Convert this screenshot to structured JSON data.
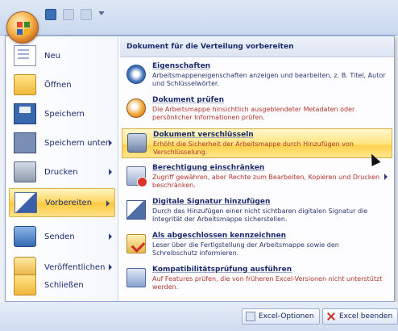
{
  "left_menu": {
    "items": [
      {
        "label": "Neu",
        "icon": "new-document-icon",
        "submenu": false
      },
      {
        "label": "Öffnen",
        "icon": "open-folder-icon",
        "submenu": false
      },
      {
        "label": "Speichern",
        "icon": "save-icon",
        "submenu": false
      },
      {
        "label": "Speichern unter",
        "icon": "save-as-icon",
        "submenu": true
      },
      {
        "label": "Drucken",
        "icon": "print-icon",
        "submenu": true
      },
      {
        "label": "Vorbereiten",
        "icon": "prepare-icon",
        "submenu": true,
        "active": true
      },
      {
        "label": "Senden",
        "icon": "send-icon",
        "submenu": true
      },
      {
        "label": "Veröffentlichen",
        "icon": "publish-icon",
        "submenu": true
      },
      {
        "label": "Schließen",
        "icon": "close-folder-icon",
        "submenu": false
      }
    ]
  },
  "right_panel": {
    "header": "Dokument für die Verteilung vorbereiten",
    "items": [
      {
        "title": "Eigenschaften",
        "desc": "Arbeitsmappeneigenschaften anzeigen und bearbeiten, z. B. Titel, Autor und Schlüsselwörter.",
        "icon": "properties-icon"
      },
      {
        "title": "Dokument prüfen",
        "desc": "Die Arbeitsmappe hinsichtlich ausgeblendeter Metadaten oder persönlicher Informationen prüfen.",
        "icon": "inspect-document-icon"
      },
      {
        "title": "Dokument verschlüsseln",
        "desc": "Erhöht die Sicherheit der Arbeitsmappe durch Hinzufügen von Verschlüsselung.",
        "icon": "encrypt-icon",
        "active": true
      },
      {
        "title": "Berechtigung einschränken",
        "desc": "Zugriff gewähren, aber Rechte zum Bearbeiten, Kopieren und Drucken beschränken.",
        "icon": "restrict-permission-icon",
        "submenu": true
      },
      {
        "title": "Digitale Signatur hinzufügen",
        "desc": "Durch das Hinzufügen einer nicht sichtbaren digitalen Signatur die Integrität der Arbeitsmappe sicherstellen.",
        "icon": "digital-signature-icon"
      },
      {
        "title": "Als abgeschlossen kennzeichnen",
        "desc": "Leser über die Fertigstellung der Arbeitsmappe sowie den Schreibschutz informieren.",
        "icon": "mark-final-icon"
      },
      {
        "title": "Kompatibilitätsprüfung ausführen",
        "desc": "Auf Features prüfen, die von früheren Excel-Versionen nicht unterstützt werden.",
        "icon": "compatibility-check-icon"
      }
    ]
  },
  "bottom": {
    "options_label": "Excel-Optionen",
    "exit_label": "Excel beenden"
  }
}
